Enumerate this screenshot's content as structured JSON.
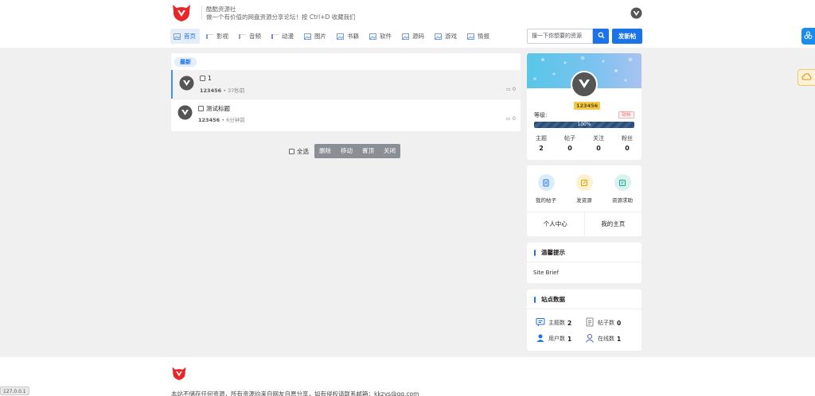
{
  "header": {
    "site_name": "酷酷资源社",
    "slogan": "做一个有价值的网盘资源分享论坛！按 Ctrl+D 收藏我们",
    "search_placeholder": "搜一下你想要的资源",
    "post_button": "发新帖"
  },
  "nav": [
    {
      "label": "首页",
      "active": true
    },
    {
      "label": "影视"
    },
    {
      "label": "音频"
    },
    {
      "label": "动漫"
    },
    {
      "label": "图片"
    },
    {
      "label": "书籍"
    },
    {
      "label": "软件"
    },
    {
      "label": "源码"
    },
    {
      "label": "游戏"
    },
    {
      "label": "情报"
    }
  ],
  "threads": {
    "tab": "最新",
    "items": [
      {
        "title": "1",
        "author": "123456",
        "time": "37秒前",
        "replies": "0"
      },
      {
        "title": "测试标题",
        "author": "123456",
        "time": "6分钟前",
        "replies": "0"
      }
    ]
  },
  "actions": {
    "select_all": "全选",
    "buttons": [
      "删除",
      "移动",
      "置顶",
      "关闭"
    ]
  },
  "user": {
    "name": "123456",
    "level_label": "等级:",
    "level_badge": "站长",
    "progress_text": "100%",
    "progress": 1.0,
    "stats": [
      {
        "label": "主题",
        "value": "2"
      },
      {
        "label": "帖子",
        "value": "0"
      },
      {
        "label": "关注",
        "value": "0"
      },
      {
        "label": "粉丝",
        "value": "0"
      }
    ]
  },
  "shortcuts": {
    "items": [
      {
        "label": "我的帖子",
        "icon": "document-icon",
        "bg": "#dcecfb",
        "color": "#1a73e8"
      },
      {
        "label": "发资源",
        "icon": "edit-icon",
        "bg": "#fdf1cf",
        "color": "#e0a000"
      },
      {
        "label": "资源求助",
        "icon": "help-icon",
        "bg": "#d9f2ee",
        "color": "#1aa38c"
      }
    ],
    "links": [
      "个人中心",
      "我的主页"
    ]
  },
  "notice": {
    "title": "温馨提示",
    "text": "Site Brief"
  },
  "site_stats": {
    "title": "站点数据",
    "items": [
      {
        "label": "主题数",
        "value": "2",
        "icon": "chat-icon"
      },
      {
        "label": "帖子数",
        "value": "0",
        "icon": "file-icon"
      },
      {
        "label": "用户数",
        "value": "1",
        "icon": "users-icon"
      },
      {
        "label": "在线数",
        "value": "1",
        "icon": "person-icon"
      }
    ]
  },
  "footer": {
    "text": "本站不储存任何资源，所有资源均来自网友自愿分享，如有侵权请联系邮箱：kkzys@qq.com"
  },
  "status_url": "127.0.0.1",
  "colors": {
    "accent": "#1a73e8",
    "brand_red": "#e8262a"
  }
}
